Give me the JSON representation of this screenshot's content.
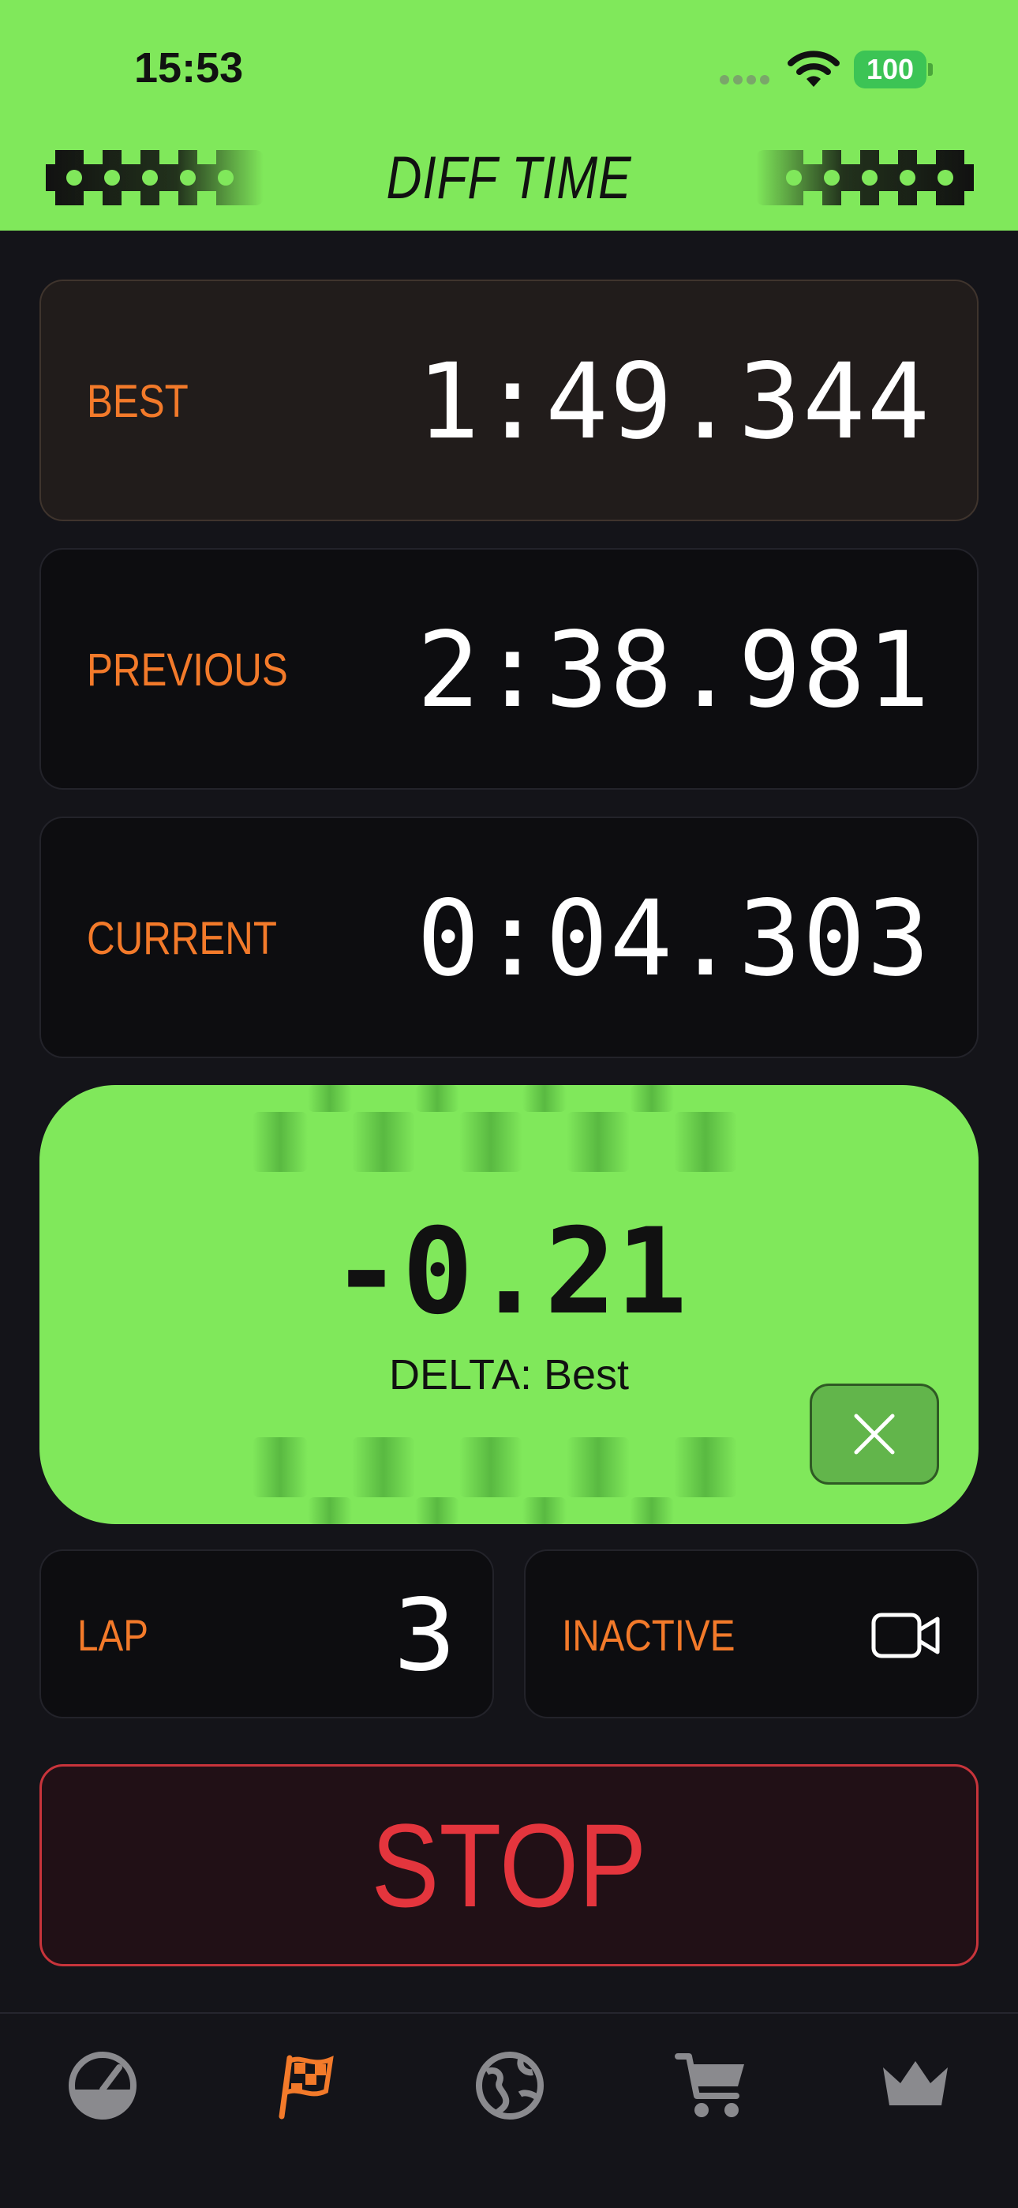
{
  "status_bar": {
    "time": "15:53",
    "battery": "100"
  },
  "header": {
    "title": "DIFF TIME"
  },
  "times": {
    "best": {
      "label": "BEST",
      "value": "1:49.344"
    },
    "previous": {
      "label": "PREVIOUS",
      "value": "2:38.981"
    },
    "current": {
      "label": "CURRENT",
      "value": "0:04.303"
    }
  },
  "delta": {
    "value": "-0.21",
    "label": "DELTA: Best"
  },
  "lap": {
    "label": "LAP",
    "value": "3"
  },
  "camera": {
    "label": "INACTIVE",
    "icon": "video-camera-icon"
  },
  "stop_button": {
    "label": "STOP"
  },
  "tabbar": {
    "active": "flag",
    "items": [
      "speedometer-icon",
      "racing-flag-icon",
      "globe-icon",
      "cart-icon",
      "crown-icon"
    ]
  },
  "colors": {
    "accent_green": "#80e85b",
    "label_orange": "#f37a2a",
    "stop_red": "#e4353d",
    "background": "#141419"
  }
}
